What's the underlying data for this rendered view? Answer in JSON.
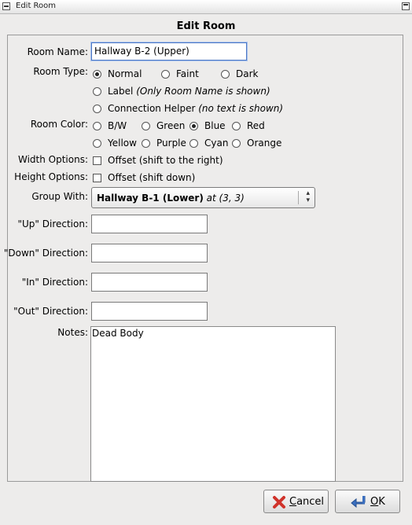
{
  "window": {
    "title": "Edit Room"
  },
  "dialog": {
    "heading": "Edit Room"
  },
  "room_name": {
    "label": "Room Name:",
    "value": "Hallway B-2 (Upper)"
  },
  "room_type": {
    "label": "Room Type:",
    "selected": "Normal",
    "options": {
      "normal": "Normal",
      "faint": "Faint",
      "dark": "Dark",
      "label": "Label",
      "label_note": "(Only Room Name is shown)",
      "connection": "Connection Helper",
      "connection_note": "(no text is shown)"
    }
  },
  "room_color": {
    "label": "Room Color:",
    "selected": "Blue",
    "options": [
      "B/W",
      "Green",
      "Blue",
      "Red",
      "Yellow",
      "Purple",
      "Cyan",
      "Orange"
    ]
  },
  "width_options": {
    "label": "Width Options:",
    "option": "Offset (shift to the right)",
    "checked": false
  },
  "height_options": {
    "label": "Height Options:",
    "option": "Offset (shift down)",
    "checked": false
  },
  "group_with": {
    "label": "Group With:",
    "room": "Hallway B-1 (Lower)",
    "at": "at (3, 3)",
    "icon": "updown-arrows-icon"
  },
  "directions": {
    "up": {
      "label": "\"Up\" Direction:",
      "value": ""
    },
    "down": {
      "label": "\"Down\" Direction:",
      "value": ""
    },
    "in": {
      "label": "\"In\" Direction:",
      "value": ""
    },
    "out": {
      "label": "\"Out\" Direction:",
      "value": ""
    }
  },
  "notes": {
    "label": "Notes:",
    "value": "Dead Body"
  },
  "buttons": {
    "cancel": {
      "mnemonic": "C",
      "rest": "ancel",
      "icon": "cancel-x-icon"
    },
    "ok": {
      "mnemonic": "O",
      "rest": "K",
      "icon": "ok-arrow-icon"
    }
  },
  "colors": {
    "focus": "#4e78c4",
    "cancel_icon": "#d0332b",
    "ok_icon": "#3a6fc0"
  }
}
